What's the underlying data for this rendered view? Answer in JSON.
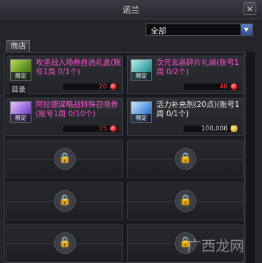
{
  "window": {
    "title": "诺兰",
    "close_label": "✕"
  },
  "filter": {
    "selected": "全部",
    "arrow": "▼"
  },
  "tabs": [
    {
      "label": "商店"
    }
  ],
  "items": [
    {
      "name": "攻坚战入场券自选礼盒(账号1周 0/1个)",
      "badge": "限定",
      "price": "20",
      "currency": "red-gem-icon",
      "name_color": "pink",
      "tag": "目录"
    },
    {
      "name": "次元玄晶碎片礼袋(账号1周 0/2个)",
      "badge": "限定",
      "price": "40",
      "currency": "red-gem-icon",
      "name_color": "pink"
    },
    {
      "name": "阿拉德谋略战特殊召唤券(账号1周 0/10个)",
      "badge": "限定",
      "price": "15",
      "currency": "red-gem-icon",
      "name_color": "pink"
    },
    {
      "name": "活力补充剂(20点)(账号1周 0/1个)",
      "badge": "限定",
      "price": "100,000",
      "currency": "gold-coin-icon",
      "name_color": "white"
    }
  ],
  "locked_slots": 6,
  "watermark": "广西龙网"
}
